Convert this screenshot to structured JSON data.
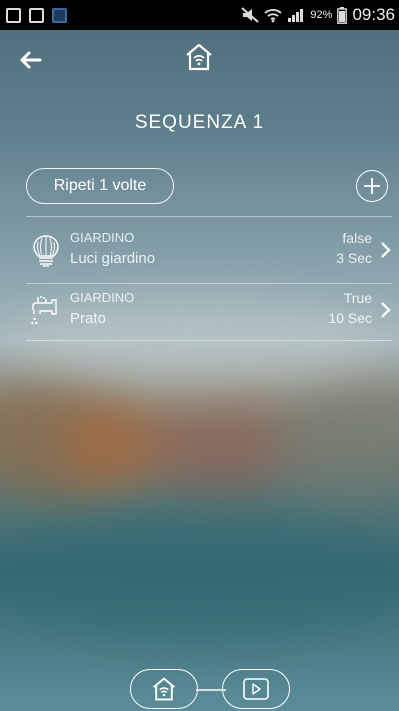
{
  "status_bar": {
    "battery": "92%",
    "time": "09:36",
    "icons": [
      "image-icon",
      "s-app-icon",
      "camera-app-icon",
      "mute-icon",
      "wifi-icon",
      "signal-icon",
      "battery-icon"
    ]
  },
  "header": {
    "back_icon": "arrow-left-icon",
    "home_icon": "home-wifi-icon"
  },
  "title": "SEQUENZA 1",
  "repeat_label": "Ripeti 1 volte",
  "add_icon": "plus-circle-icon",
  "steps": [
    {
      "zone": "GIARDINO",
      "name": "Luci giardino",
      "value": "false",
      "duration": "3 Sec",
      "icon": "lightbulb-icon"
    },
    {
      "zone": "GIARDINO",
      "name": "Prato",
      "value": "True",
      "duration": "10 Sec",
      "icon": "sprinkler-tap-icon"
    }
  ],
  "bottom_nav": {
    "home_icon": "home-wifi-icon",
    "play_icon": "play-icon"
  },
  "colors": {
    "text": "#ffffff",
    "statusbar": "#000000"
  }
}
